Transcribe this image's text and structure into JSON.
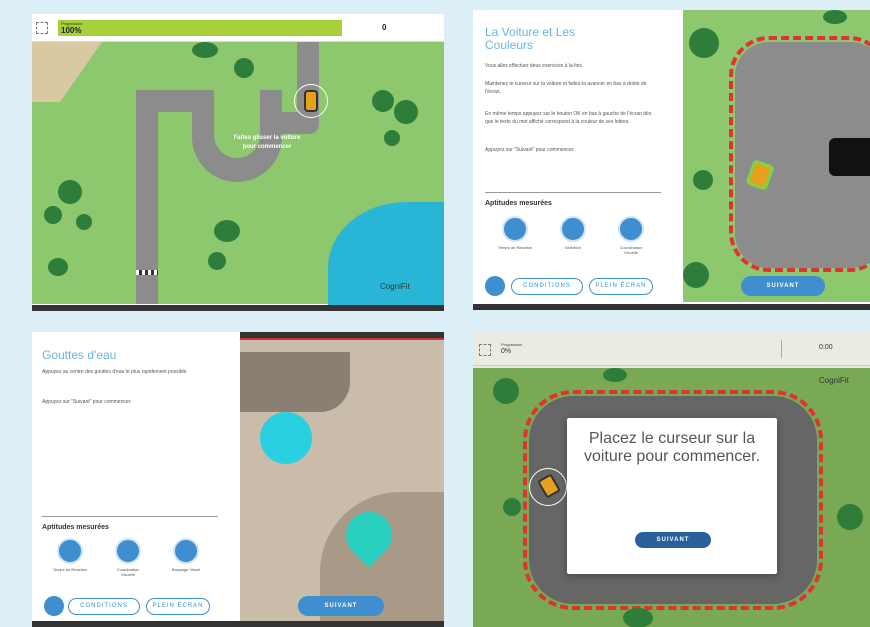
{
  "panel1": {
    "progress_label_small": "Progression",
    "progress_value": "100%",
    "progress_fraction": 1.0,
    "score": "0",
    "drag_hint": "Faites glisser la voiture pour commencer",
    "logo": "CogniFit"
  },
  "panel2": {
    "title": "La Voiture et Les Couleurs",
    "paragraphs": [
      "Vous allez effectuer deux exercices à la fois.",
      "Maintenez le curseur sur la voiture et faites-la avancer en bas à droite de l'écran.",
      "En même temps appuyez sur le bouton OK en bas à gauche de l'écran dès que le texte du mot affiché correspond à la couleur de ses lettres.",
      "Appuyez sur \"Suivant\" pour commencer."
    ],
    "skills_heading": "Aptitudes mesurées",
    "skills": [
      "Temps de Réaction",
      "Inhibition",
      "Coordination Visuelle"
    ],
    "btn_conditions": "CONDITIONS",
    "btn_fullscreen": "PLEIN ÉCRAN",
    "btn_next": "SUIVANT"
  },
  "panel3": {
    "title": "Gouttes d'eau",
    "paragraphs": [
      "Appuyez au centre des gouttes d'eau le plus rapidement possible.",
      "Appuyez sur \"Suivant\" pour commencer."
    ],
    "skills_heading": "Aptitudes mesurées",
    "skills": [
      "Temps de Réaction",
      "Coordination Visuelle",
      "Balayage Visuel"
    ],
    "btn_conditions": "CONDITIONS",
    "btn_fullscreen": "PLEIN ÉCRAN",
    "btn_next": "SUIVANT"
  },
  "panel4": {
    "progress_label_small": "Progression",
    "progress_value": "0%",
    "progress_fraction": 0.0,
    "timer": "0:00",
    "logo": "CogniFit",
    "modal_text": "Placez le curseur sur la voiture pour commencer.",
    "btn_next": "SUIVANT"
  },
  "colors": {
    "accent_blue": "#3f8ecf",
    "grass": "#8dc76e",
    "road": "#8c8c8c",
    "progress_green": "#a6cf3a",
    "water": "#29b6d6"
  }
}
